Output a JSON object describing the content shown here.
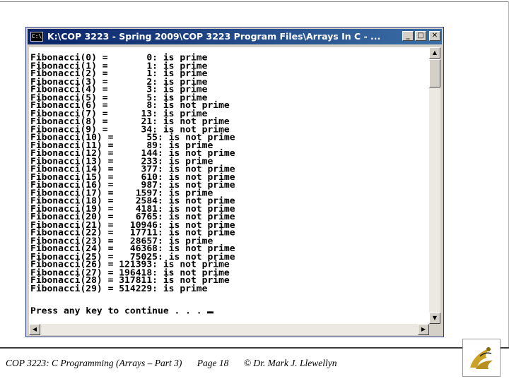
{
  "window": {
    "title": "K:\\COP 3223 - Spring 2009\\COP 3223 Program Files\\Arrays In C - ...",
    "icon_name": "console-icon",
    "icon_text": "C:\\",
    "controls": {
      "minimize": "_",
      "maximize": "□",
      "close": "✕"
    }
  },
  "console": {
    "lines": [
      "Fibonacci(0) =       0: is prime",
      "Fibonacci(1) =       1: is prime",
      "Fibonacci(2) =       1: is prime",
      "Fibonacci(3) =       2: is prime",
      "Fibonacci(4) =       3: is prime",
      "Fibonacci(5) =       5: is prime",
      "Fibonacci(6) =       8: is not prime",
      "Fibonacci(7) =      13: is prime",
      "Fibonacci(8) =      21: is not prime",
      "Fibonacci(9) =      34: is not prime",
      "Fibonacci(10) =      55: is not prime",
      "Fibonacci(11) =      89: is prime",
      "Fibonacci(12) =     144: is not prime",
      "Fibonacci(13) =     233: is prime",
      "Fibonacci(14) =     377: is not prime",
      "Fibonacci(15) =     610: is not prime",
      "Fibonacci(16) =     987: is not prime",
      "Fibonacci(17) =    1597: is prime",
      "Fibonacci(18) =    2584: is not prime",
      "Fibonacci(19) =    4181: is not prime",
      "Fibonacci(20) =    6765: is not prime",
      "Fibonacci(21) =   10946: is not prime",
      "Fibonacci(22) =   17711: is not prime",
      "Fibonacci(23) =   28657: is prime",
      "Fibonacci(24) =   46368: is not prime",
      "Fibonacci(25) =   75025: is not prime",
      "Fibonacci(26) = 121393: is not prime",
      "Fibonacci(27) = 196418: is not prime",
      "Fibonacci(28) = 317811: is not prime",
      "Fibonacci(29) = 514229: is prime"
    ],
    "prompt": "Press any key to continue . . . "
  },
  "footer": {
    "course": "COP 3223: C Programming (Arrays – Part 3)",
    "page": "Page 18",
    "author": "© Dr. Mark J. Llewellyn"
  },
  "logo": {
    "icon_name": "ucf-pegasus-logo-icon"
  },
  "colors": {
    "titlebar": "#0a246a",
    "console_bg": "#ffffff",
    "logo_gold": "#c9a227"
  }
}
